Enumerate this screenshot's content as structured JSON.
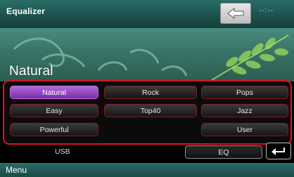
{
  "header": {
    "title": "Equalizer",
    "clock": "--:--"
  },
  "preset": {
    "current_name": "Natural"
  },
  "presets": [
    {
      "label": "Natural",
      "selected": true
    },
    {
      "label": "Rock",
      "selected": false
    },
    {
      "label": "Pops",
      "selected": false
    },
    {
      "label": "Easy",
      "selected": false
    },
    {
      "label": "Top40",
      "selected": false
    },
    {
      "label": "Jazz",
      "selected": false
    },
    {
      "label": "Powerful",
      "selected": false
    },
    {
      "label": "User",
      "selected": false
    }
  ],
  "bottom": {
    "source_label": "USB",
    "eq_label": "EQ"
  },
  "menubar": {
    "menu_label": "Menu"
  },
  "colors": {
    "accent_red": "#e01020",
    "selected_purple": "#9b4cc9",
    "teal": "#2a6e68"
  },
  "icons": {
    "back": "back-arrow-icon",
    "return": "return-icon"
  }
}
